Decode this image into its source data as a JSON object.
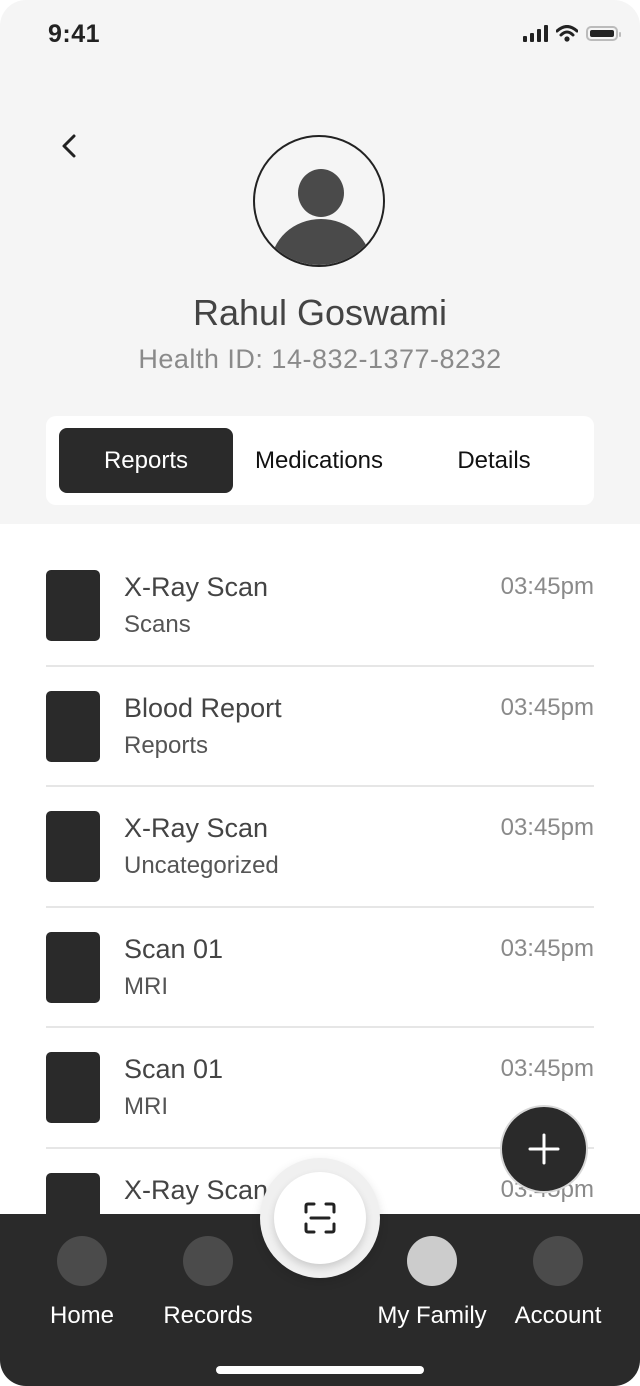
{
  "status_bar": {
    "time": "9:41",
    "icons": [
      "signal-icon",
      "wifi-icon",
      "battery-icon"
    ]
  },
  "header": {
    "back_icon": "chevron-left-icon",
    "avatar_icon": "user-avatar-icon",
    "name": "Rahul Goswami",
    "health_id": "Health ID: 14-832-1377-8232"
  },
  "tabs": [
    {
      "label": "Reports",
      "active": true
    },
    {
      "label": "Medications",
      "active": false
    },
    {
      "label": "Details",
      "active": false
    }
  ],
  "records": [
    {
      "title": "X-Ray Scan",
      "category": "Scans",
      "time": "03:45pm"
    },
    {
      "title": "Blood Report",
      "category": "Reports",
      "time": "03:45pm"
    },
    {
      "title": "X-Ray Scan",
      "category": "Uncategorized",
      "time": "03:45pm"
    },
    {
      "title": "Scan 01",
      "category": "MRI",
      "time": "03:45pm"
    },
    {
      "title": "Scan 01",
      "category": "MRI",
      "time": "03:45pm"
    },
    {
      "title": "X-Ray Scan",
      "category": "",
      "time": "03:45pm"
    }
  ],
  "fab": {
    "icon": "plus-icon"
  },
  "scan_button": {
    "icon": "scan-icon"
  },
  "bottom_nav": [
    {
      "label": "Home",
      "active": false
    },
    {
      "label": "Records",
      "active": false
    },
    {
      "label": "My Family",
      "active": true
    },
    {
      "label": "Account",
      "active": false
    }
  ]
}
